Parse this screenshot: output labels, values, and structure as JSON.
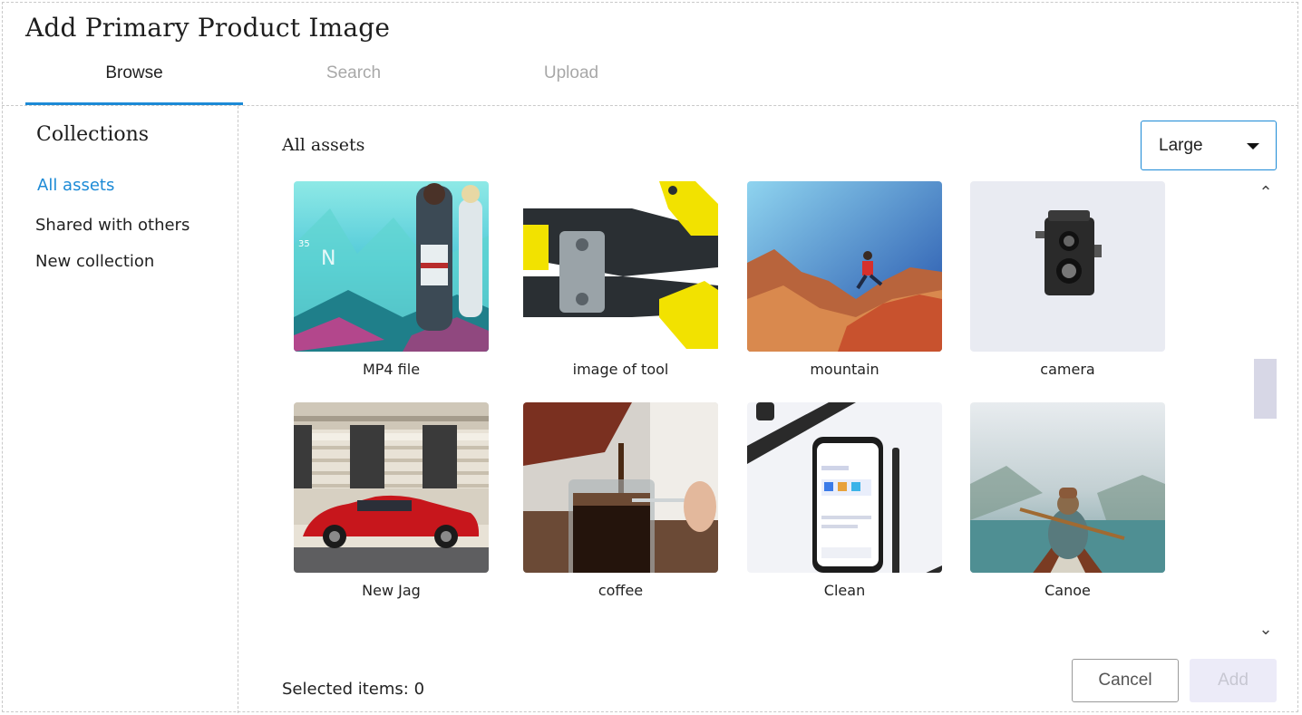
{
  "dialog": {
    "title": "Add Primary Product Image",
    "tabs": [
      {
        "label": "Browse",
        "active": true
      },
      {
        "label": "Search",
        "active": false
      },
      {
        "label": "Upload",
        "active": false
      }
    ]
  },
  "sidebar": {
    "title": "Collections",
    "items": [
      {
        "label": "All assets",
        "active": true
      },
      {
        "label": "Shared with others",
        "active": false
      },
      {
        "label": "New collection",
        "active": false
      }
    ]
  },
  "main": {
    "title": "All assets",
    "size_select": {
      "value": "Large"
    },
    "assets": [
      {
        "label": "MP4 file"
      },
      {
        "label": "image of tool"
      },
      {
        "label": "mountain"
      },
      {
        "label": "camera"
      },
      {
        "label": "New Jag"
      },
      {
        "label": "coffee"
      },
      {
        "label": "Clean"
      },
      {
        "label": "Canoe"
      }
    ]
  },
  "footer": {
    "selected_text": "Selected items: 0",
    "cancel_label": "Cancel",
    "add_label": "Add"
  },
  "colors": {
    "accent": "#1c8ad6",
    "tab_inactive": "#a8a8a8",
    "add_disabled_bg": "#ecebf8"
  }
}
